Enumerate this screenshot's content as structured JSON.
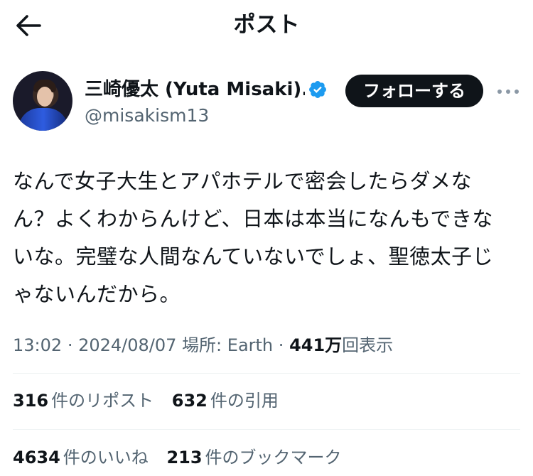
{
  "header": {
    "title": "ポスト",
    "back_icon": "arrow-left-icon"
  },
  "author": {
    "display_name": "三崎優太 (Yuta Misaki)...",
    "handle": "@misakism13",
    "verified_icon": "verified-badge-icon",
    "verified_color": "#1d9bf0",
    "follow_label": "フォローする",
    "more_icon": "more-horizontal-icon"
  },
  "post": {
    "text": "なんで女子大生とアパホテルで密会したらダメなん？よくわからんけど、日本は本当になんもできないな。完璧な人間なんていないでしょ、聖徳太子じゃないんだから。"
  },
  "meta": {
    "time": "13:02",
    "date": "2024/08/07",
    "location": "場所: Earth",
    "separator": "·",
    "views_count": "441万",
    "views_label": "回表示"
  },
  "stats": {
    "reposts_count": "316",
    "reposts_label": "件のリポスト",
    "quotes_count": "632",
    "quotes_label": "件の引用",
    "likes_count": "4634",
    "likes_label": "件のいいね",
    "bookmarks_count": "213",
    "bookmarks_label": "件のブックマーク"
  },
  "colors": {
    "text_primary": "#0f1419",
    "text_secondary": "#536471",
    "button_bg": "#0f1419",
    "divider": "#eff3f4"
  }
}
